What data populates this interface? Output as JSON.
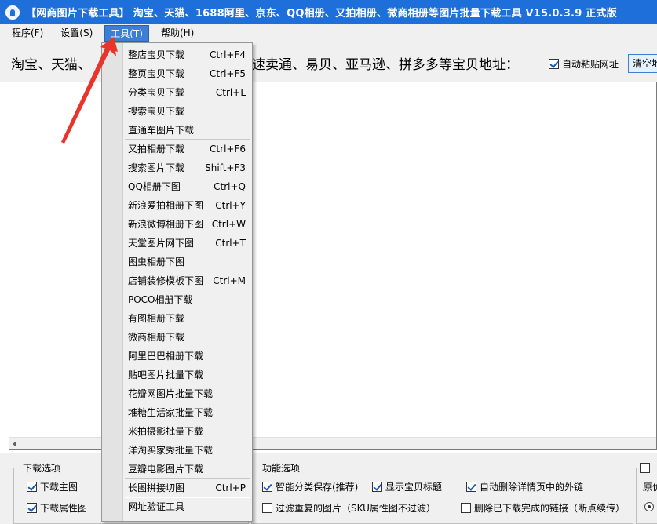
{
  "window": {
    "title": "【网商图片下载工具】 淘宝、天猫、1688阿里、京东、QQ相册、又拍相册、微商相册等图片批量下载工具 V15.0.3.9 正式版"
  },
  "menubar": {
    "program": "程序(F)",
    "settings": "设置(S)",
    "tools": "工具(T)",
    "help": "帮助(H)"
  },
  "address": {
    "label_left": "淘宝、天猫、",
    "label_right": "速卖通、易贝、亚马逊、拼多多等宝贝地址：",
    "auto_paste": "自动粘贴网址",
    "auto_paste_checked": true,
    "clear_button": "清空地址"
  },
  "tools_menu": {
    "items": [
      {
        "label": "整店宝贝下载",
        "shortcut": "Ctrl+F4"
      },
      {
        "label": "整页宝贝下载",
        "shortcut": "Ctrl+F5"
      },
      {
        "label": "分类宝贝下载",
        "shortcut": "Ctrl+L"
      },
      {
        "label": "搜索宝贝下载",
        "shortcut": ""
      },
      {
        "label": "直通车图片下载",
        "shortcut": ""
      },
      {
        "label": "又拍相册下载",
        "shortcut": "Ctrl+F6"
      },
      {
        "label": "搜索图片下载",
        "shortcut": "Shift+F3"
      },
      {
        "label": "QQ相册下图",
        "shortcut": "Ctrl+Q"
      },
      {
        "label": "新浪爱拍相册下图",
        "shortcut": "Ctrl+Y"
      },
      {
        "label": "新浪微博相册下图",
        "shortcut": "Ctrl+W"
      },
      {
        "label": "天堂图片网下图",
        "shortcut": "Ctrl+T"
      },
      {
        "label": "图虫相册下图",
        "shortcut": ""
      },
      {
        "label": "店铺装修模板下图",
        "shortcut": "Ctrl+M"
      },
      {
        "label": "POCO相册下载",
        "shortcut": ""
      },
      {
        "label": "有图相册下载",
        "shortcut": ""
      },
      {
        "label": "微商相册下载",
        "shortcut": ""
      },
      {
        "label": "阿里巴巴相册下载",
        "shortcut": ""
      },
      {
        "label": "贴吧图片批量下载",
        "shortcut": ""
      },
      {
        "label": "花瓣网图片批量下载",
        "shortcut": ""
      },
      {
        "label": "堆糖生活家批量下载",
        "shortcut": ""
      },
      {
        "label": "米拍摄影批量下载",
        "shortcut": ""
      },
      {
        "label": "洋淘买家秀批量下载",
        "shortcut": ""
      },
      {
        "label": "豆瓣电影图片下载",
        "shortcut": ""
      },
      {
        "label": "长图拼接切图",
        "shortcut": "Ctrl+P"
      },
      {
        "label": "网址验证工具",
        "shortcut": ""
      }
    ]
  },
  "download_options": {
    "legend": "下载选项",
    "main_image": "下载主图",
    "main_image_checked": true,
    "attr_image": "下载属性图",
    "attr_image_checked": true
  },
  "function_options": {
    "legend": "功能选项",
    "smart_save": "智能分类保存(推荐)",
    "smart_save_checked": true,
    "show_title": "显示宝贝标题",
    "show_title_checked": true,
    "auto_delete_links": "自动删除详情页中的外链",
    "auto_delete_links_checked": true,
    "filter_duplicates": "过滤重复的图片（SKU属性图不过滤）",
    "filter_duplicates_checked": false,
    "delete_finished": "删除已下载完成的链接（断点续传）",
    "delete_finished_checked": false
  },
  "right_panel": {
    "partial_label": "原价"
  },
  "colors": {
    "titlebar": "#1e6fd9",
    "menu_active": "#3c7fd4",
    "annotation_arrow": "#e8352b"
  }
}
